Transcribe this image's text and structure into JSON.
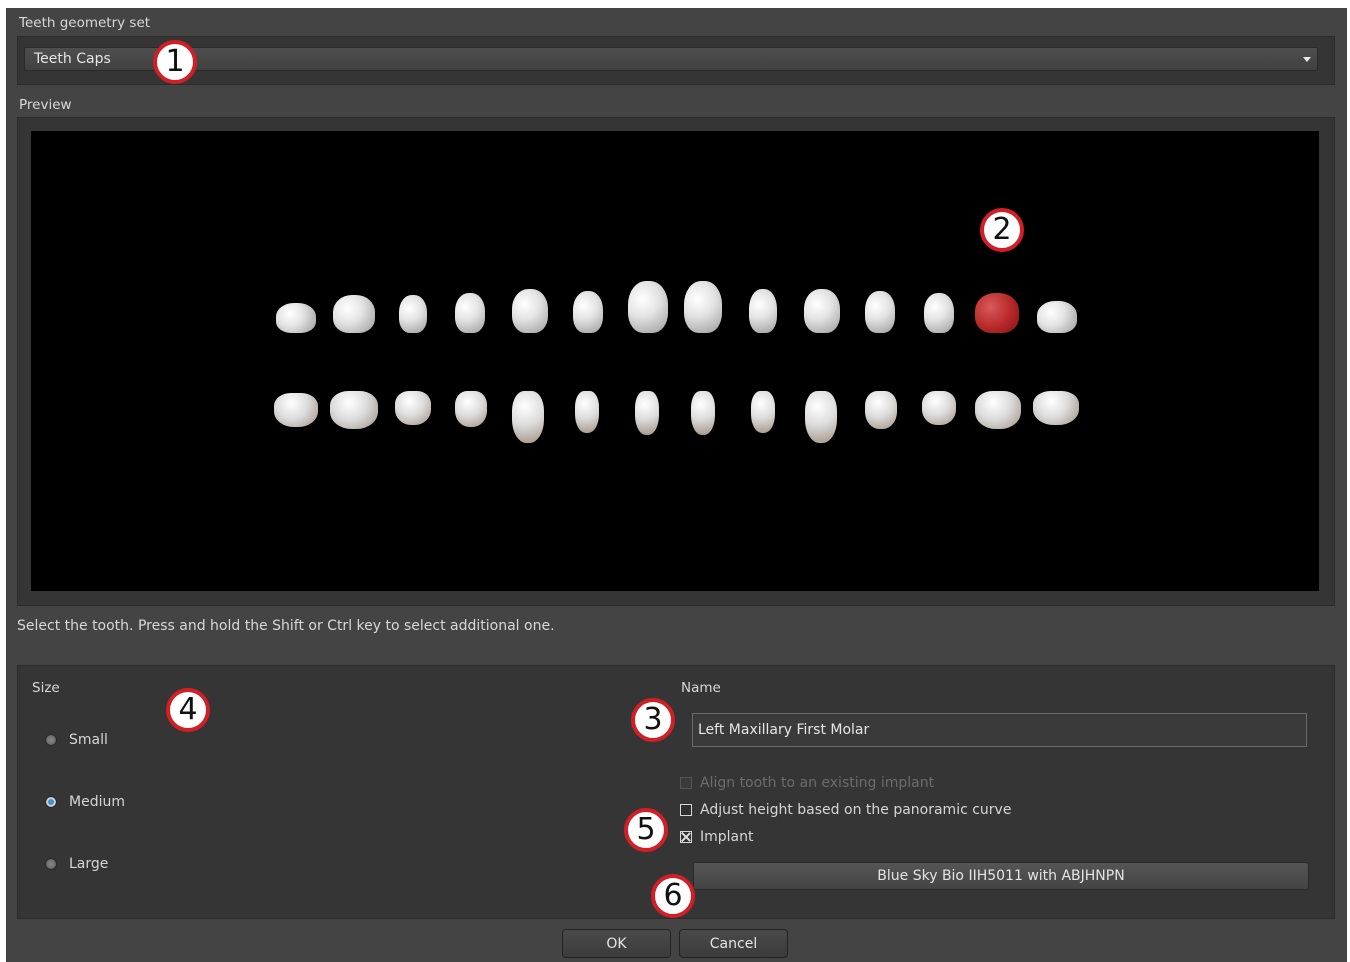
{
  "geometry_set": {
    "label": "Teeth geometry set",
    "selected": "Teeth Caps"
  },
  "preview": {
    "label": "Preview",
    "selected_tooth_color": "#c03030"
  },
  "instruction": "Select the tooth. Press and hold the Shift or Ctrl key to select additional one.",
  "size": {
    "label": "Size",
    "options": [
      {
        "label": "Small",
        "selected": false
      },
      {
        "label": "Medium",
        "selected": true
      },
      {
        "label": "Large",
        "selected": false
      }
    ]
  },
  "name": {
    "label": "Name",
    "value": "Left Maxillary First Molar"
  },
  "checkboxes": {
    "align": {
      "label": "Align tooth to an existing implant",
      "checked": false,
      "enabled": false
    },
    "adjust": {
      "label": "Adjust height based on the panoramic curve",
      "checked": false,
      "enabled": true
    },
    "implant": {
      "label": "Implant",
      "checked": true,
      "enabled": true
    }
  },
  "implant_button": "Blue Sky Bio IIH5011 with ABJHNPN",
  "buttons": {
    "ok": "OK",
    "cancel": "Cancel"
  },
  "markers": [
    "1",
    "2",
    "3",
    "4",
    "5",
    "6"
  ],
  "colors": {
    "dialog_bg": "#444444",
    "panel_bg": "#353535",
    "marker_ring": "#d21f26"
  }
}
